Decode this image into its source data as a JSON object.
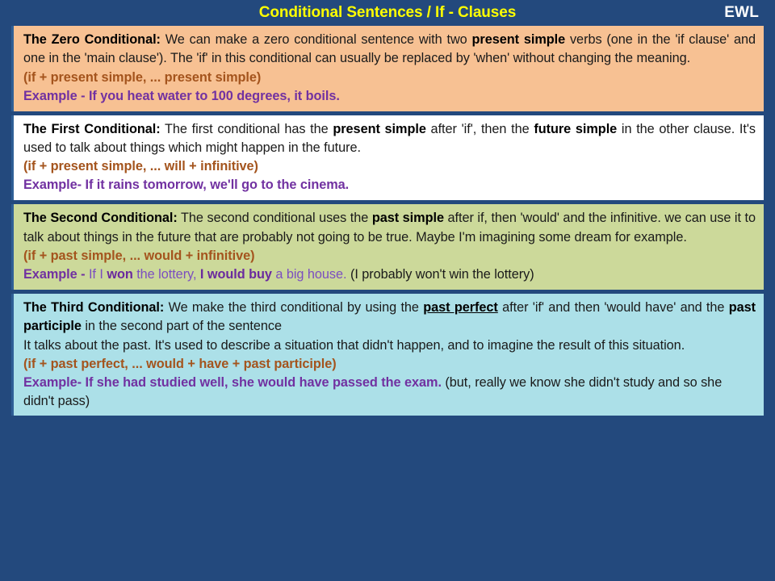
{
  "header": {
    "title": "Conditional Sentences / If - Clauses",
    "brand": "EWL",
    "title_color": "#ffff00",
    "brand_color": "#ffffff",
    "background_color": "#23497d"
  },
  "cards": [
    {
      "id": "zero-conditional",
      "background_color": "#f7c193",
      "lead": "The Zero Conditional:",
      "body_part_1": " We can make a zero conditional sentence with two ",
      "body_bold_1": "present simple",
      "body_part_2": " verbs (one in the 'if clause' and one in the 'main clause'). The 'if' in this conditional can usually be replaced by 'when' without changing the meaning.",
      "formula": "(if + present simple, ... present simple)",
      "example_label": "Example - ",
      "example_text": "If you heat water to 100 degrees, it boils."
    },
    {
      "id": "first-conditional",
      "background_color": "#ffffff",
      "lead": "The First Conditional:",
      "body_part_1": " The first conditional has the ",
      "body_bold_1": "present simple",
      "body_part_2": " after 'if', then the ",
      "body_bold_2": "future simple",
      "body_part_3": " in the other clause. It's used to talk about things which might happen in the future.",
      "formula": "(if + present simple, ... will + infinitive)",
      "example_label": "Example- ",
      "example_text": "If it rains tomorrow, we'll go to the cinema."
    },
    {
      "id": "second-conditional",
      "background_color": "#ccd99a",
      "lead": "The Second Conditional:",
      "body_part_1": " The second conditional uses the ",
      "body_bold_1": "past simple",
      "body_part_2": " after if, then 'would' and the infinitive. we can use it to talk about things in the future that are probably not going to be true. Maybe I'm imagining some dream for example.",
      "formula": "(if + past simple, ... would + infinitive)",
      "example_label": "Example - ",
      "example_seg_1": "If I ",
      "example_seg_2": "won",
      "example_seg_3": " the lottery, ",
      "example_seg_4": "I would buy",
      "example_seg_5": " a big house. ",
      "example_note": "(I probably won't win the lottery)"
    },
    {
      "id": "third-conditional",
      "background_color": "#ace0e8",
      "lead": "The Third Conditional:",
      "body_part_1": " We make the third conditional by using the ",
      "body_bold_underline_1": "past perfect",
      "body_part_2": " after 'if' and then 'would have' and the ",
      "body_bold_2": "past participle",
      "body_part_3": " in the second part of the sentence",
      "body_line_2": "It talks about the past. It's used to describe a situation that didn't happen, and to imagine the result of this situation.",
      "formula": "(if + past perfect, ... would + have + past participle)",
      "example_label": "Example- ",
      "example_text": "If she had studied well, she would have passed the exam. ",
      "example_note": "(but, really we know she didn't study and so she didn't pass)"
    }
  ],
  "colors": {
    "formula_text": "#a4541d",
    "example_text": "#7131a1",
    "body_text": "#1a1a1a",
    "card_border": "#2f5f96"
  }
}
